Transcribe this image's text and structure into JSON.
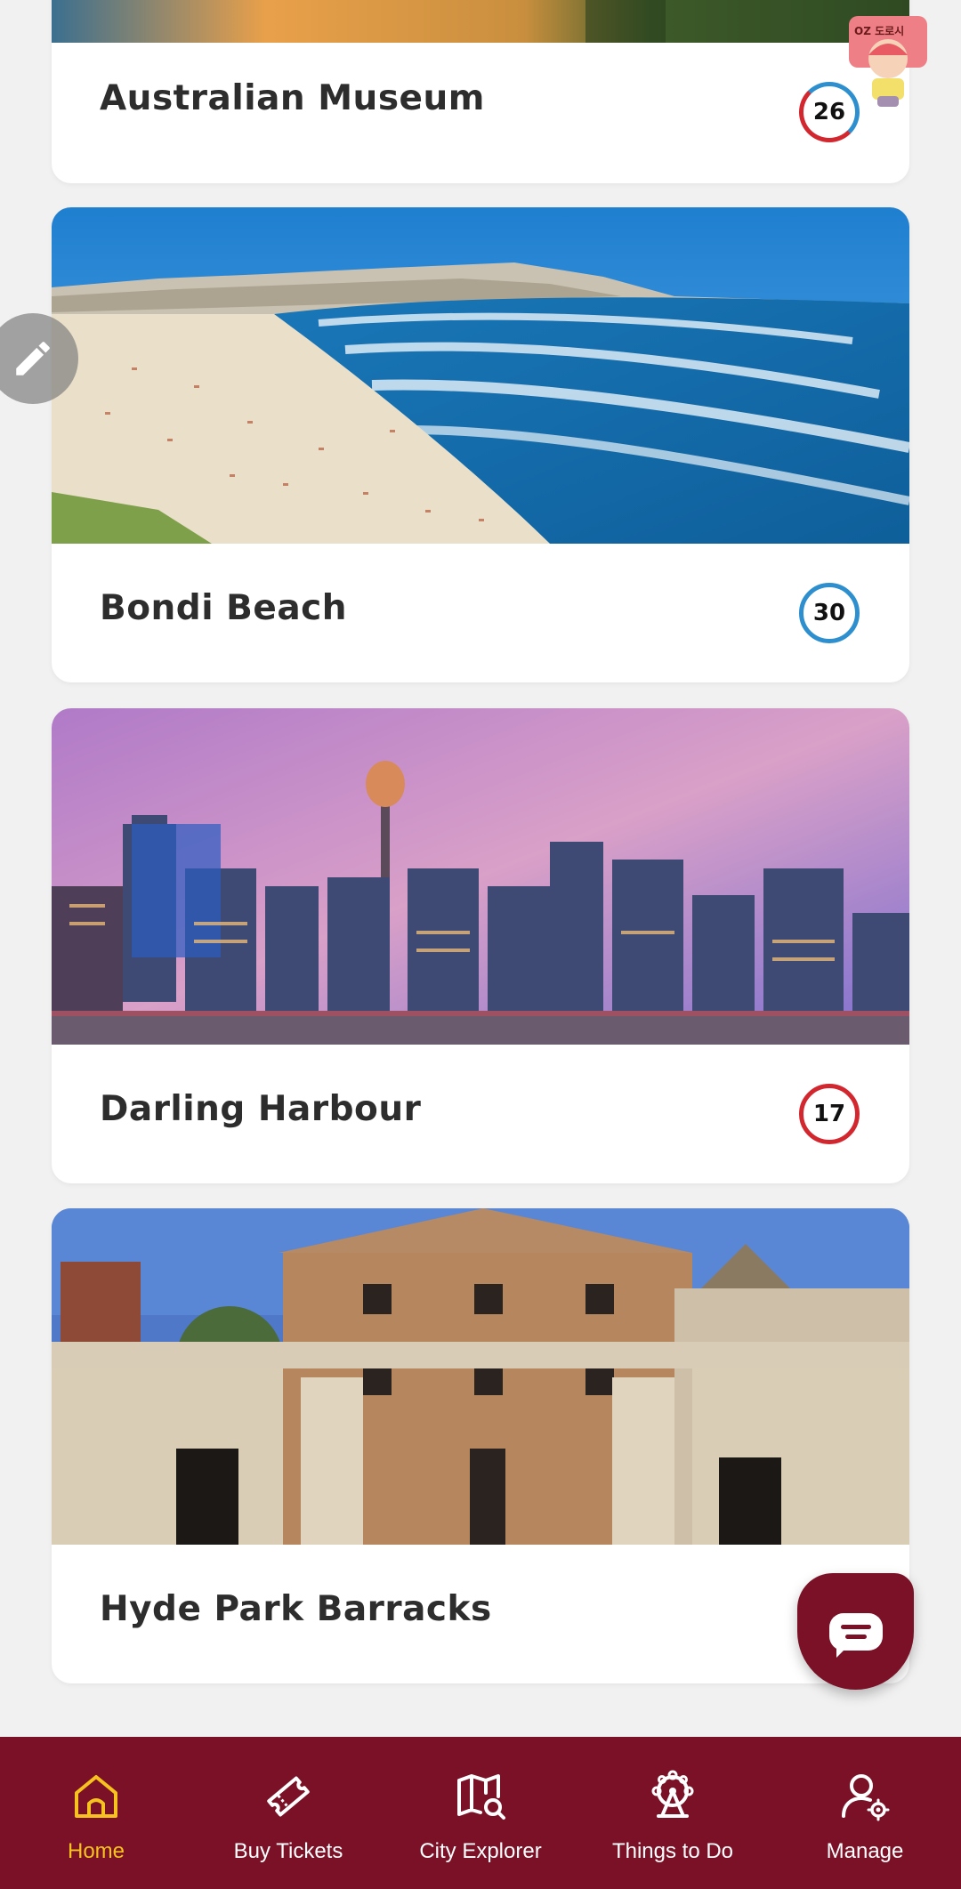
{
  "cards": [
    {
      "title": "Australian Museum",
      "count": "26",
      "badge": "split"
    },
    {
      "title": "Bondi Beach",
      "count": "30",
      "badge": "blue"
    },
    {
      "title": "Darling Harbour",
      "count": "17",
      "badge": "red"
    },
    {
      "title": "Hyde Park Barracks",
      "count": "",
      "badge": "red"
    }
  ],
  "mascot": {
    "label": "OZ 도로시"
  },
  "nav": {
    "items": [
      {
        "label": "Home",
        "icon": "home-icon",
        "active": true
      },
      {
        "label": "Buy Tickets",
        "icon": "ticket-icon",
        "active": false
      },
      {
        "label": "City Explorer",
        "icon": "map-search-icon",
        "active": false
      },
      {
        "label": "Things to Do",
        "icon": "ferris-wheel-icon",
        "active": false
      },
      {
        "label": "Manage",
        "icon": "user-settings-icon",
        "active": false
      }
    ]
  },
  "colors": {
    "brand": "#7a1126",
    "active": "#f6c21f",
    "badge_red": "#d2272e",
    "badge_blue": "#2e8fcf",
    "background": "#f1f1f1"
  }
}
